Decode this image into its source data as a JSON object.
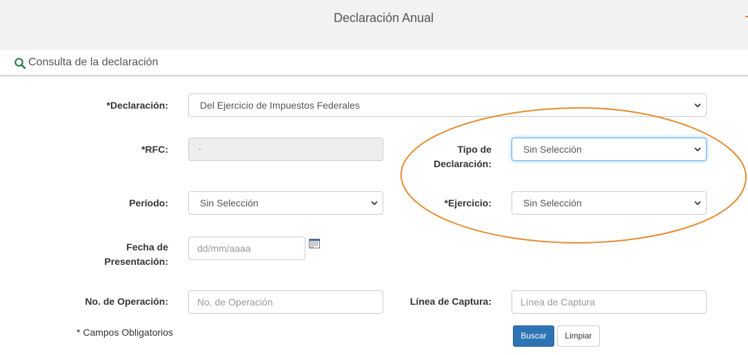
{
  "header": {
    "title": "Declaración Anual"
  },
  "section": {
    "title": "Consulta de la declaración",
    "icon": "search-icon"
  },
  "form": {
    "declaracion": {
      "label": "*Declaración:",
      "value": "Del Ejercicio de Impuestos Federales"
    },
    "rfc": {
      "label": "*RFC:",
      "value": ""
    },
    "tipo_declaracion": {
      "label_line1": "Tipo de",
      "label_line2": "Declaración:",
      "value": "Sin Selección"
    },
    "periodo": {
      "label": "Período:",
      "value": "Sin Selección"
    },
    "ejercicio": {
      "label": "*Ejercicio:",
      "value": "Sin Selección"
    },
    "fecha_presentacion": {
      "label_line1": "Fecha de",
      "label_line2": "Presentación:",
      "placeholder": "dd/mm/aaaa",
      "icon": "calendar-icon"
    },
    "no_operacion": {
      "label": "No. de Operación:",
      "placeholder": "No. de Operación"
    },
    "linea_captura": {
      "label": "Línea de Captura:",
      "placeholder": "Línea de Captura"
    }
  },
  "note": "* Campos Obligatorios",
  "buttons": {
    "search": "Buscar",
    "clear": "Limpiar"
  },
  "colors": {
    "primary": "#2e74b5",
    "highlight_ellipse": "#e48a2e",
    "section_icon": "#2e7d4f",
    "header_bg": "#f2f2f2"
  }
}
